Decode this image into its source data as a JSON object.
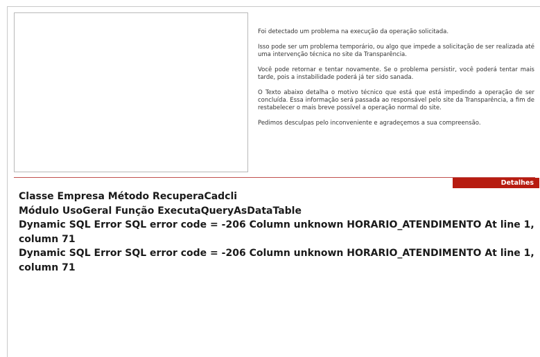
{
  "message": {
    "paragraphs": [
      "Foi detectado um problema na execução da operação solicitada.",
      "Isso pode ser um problema temporário, ou algo que impede a solicitação de ser realizada até uma intervenção técnica no site da Transparência.",
      "Você pode retornar e tentar novamente. Se o problema persistir, você poderá tentar mais tarde, pois a instabilidade poderá já ter sido sanada.",
      "O Texto abaixo detalha o motivo técnico que está que está impedindo a operação de ser concluída. Essa informação será passada ao responsável pelo site da Transparência, a fim de restabelecer o mais breve possível a operação normal do site.",
      "Pedimos desculpas pelo inconveniente e agradeçemos a sua compreensão."
    ]
  },
  "details_label": "Detalhes",
  "errors": [
    "Classe Empresa Método RecuperaCadcli",
    "Módulo UsoGeral Função ExecutaQueryAsDataTable",
    "Dynamic SQL Error SQL error code = -206 Column unknown HORARIO_ATENDIMENTO At line 1, column 71",
    "Dynamic SQL Error SQL error code = -206 Column unknown HORARIO_ATENDIMENTO At line 1, column 71"
  ],
  "colors": {
    "accent": "#b71c10",
    "divider": "#c0504d"
  }
}
